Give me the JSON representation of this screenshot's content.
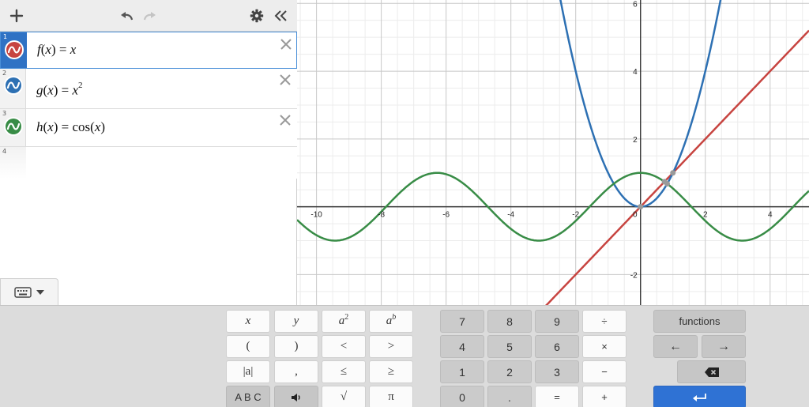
{
  "expressions": [
    {
      "index": "1",
      "name": "f",
      "arg": "x",
      "rhs": "x",
      "exponent": "",
      "color": "#c74440",
      "active": true
    },
    {
      "index": "2",
      "name": "g",
      "arg": "x",
      "rhs": "x",
      "exponent": "2",
      "color": "#2d70b3",
      "active": false
    },
    {
      "index": "3",
      "name": "h",
      "arg": "x",
      "rhs_fn": "cos",
      "rhs_arg": "x",
      "color": "#388c46",
      "active": false
    },
    {
      "index": "4"
    }
  ],
  "toolbar": {
    "add_icon": "plus-icon",
    "undo_icon": "undo-icon",
    "redo_icon": "redo-icon",
    "settings_icon": "gear-icon",
    "collapse_icon": "double-chevron-left-icon"
  },
  "graph": {
    "x_range": [
      -10.6,
      5.2
    ],
    "y_range": [
      -2.9,
      6.1
    ],
    "x_tick_labels": [
      "-10",
      "-8",
      "-6",
      "-4",
      "-2",
      "0",
      "2",
      "4"
    ],
    "y_tick_labels": [
      "6",
      "4",
      "2",
      "-2"
    ],
    "colors": {
      "f": "#c74440",
      "g": "#2d70b3",
      "h": "#388c46",
      "axis": "#333333",
      "grid_major": "#c8c8c8",
      "grid_minor": "#ececec"
    }
  },
  "keypad": {
    "left": {
      "row1": [
        "x",
        "y",
        "a",
        "a"
      ],
      "row1_sup": [
        "",
        "",
        "2",
        "b"
      ],
      "row2": [
        "(",
        ")",
        "<",
        ">"
      ],
      "row3": [
        "|a|",
        ",",
        "≤",
        "≥"
      ],
      "row4": [
        "A B C",
        "",
        "√",
        "π"
      ]
    },
    "numbers": {
      "row1": [
        "7",
        "8",
        "9",
        "÷"
      ],
      "row2": [
        "4",
        "5",
        "6",
        "×"
      ],
      "row3": [
        "1",
        "2",
        "3",
        "−"
      ],
      "row4": [
        "0",
        ".",
        "=",
        "+"
      ]
    },
    "functions_label": "functions",
    "left_arrow": "←",
    "right_arrow": "→"
  }
}
